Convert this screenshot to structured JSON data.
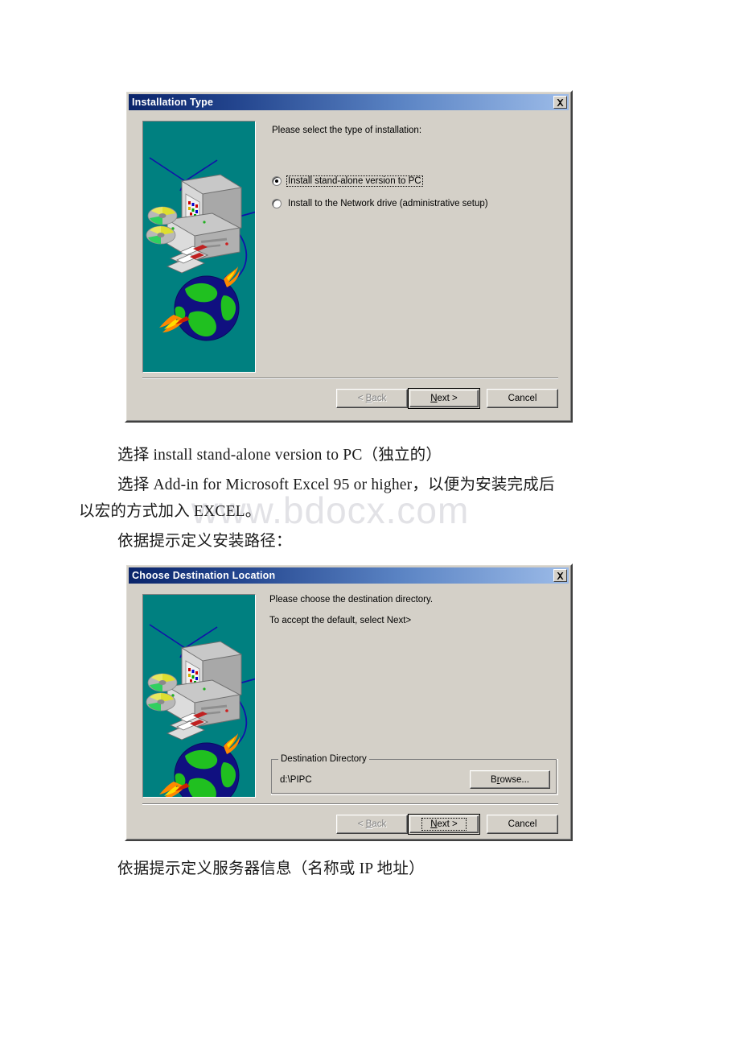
{
  "document": {
    "watermark": "www.bdocx.com",
    "paragraphs": [
      {
        "id": "p1",
        "text": "选择 install stand-alone version to PC（独立的）"
      },
      {
        "id": "p2",
        "text": "选择 Add-in for Microsoft Excel 95 or higher，以便为安装完成后"
      },
      {
        "id": "p3",
        "text": "以宏的方式加入 EXCEL。"
      },
      {
        "id": "p4",
        "text": "依据提示定义安装路径："
      },
      {
        "id": "p5",
        "text": "依据提示定义服务器信息（名称或 IP 地址）"
      }
    ]
  },
  "colors": {
    "dialog_face": "#d4d0c8",
    "title_gradient_start": "#0a246a",
    "title_gradient_end": "#9cbbe8",
    "graphic_background": "#008080",
    "page_background": "#ffffff",
    "watermark": "#e2e2e6"
  },
  "dialog1": {
    "title": "Installation Type",
    "close_tooltip": "Close",
    "prompt": "Please select the type of installation:",
    "options": [
      {
        "label": "Install stand-alone version to PC",
        "accel": "I",
        "selected": true,
        "focused": true
      },
      {
        "label": "Install to the Network drive (administrative setup)",
        "accel": "I",
        "selected": false,
        "focused": false
      }
    ],
    "buttons": {
      "back": {
        "label_pre": "< ",
        "accel": "B",
        "label_post": "ack",
        "enabled": false,
        "default": false
      },
      "next": {
        "label_pre": "",
        "accel": "N",
        "label_post": "ext >",
        "enabled": true,
        "default": true,
        "focused": false
      },
      "cancel": {
        "label": "Cancel",
        "enabled": true,
        "default": false
      }
    }
  },
  "dialog2": {
    "title": "Choose Destination Location",
    "close_tooltip": "Close",
    "prompt_line1": "Please choose the destination directory.",
    "prompt_line2": "To accept the default, select  Next>",
    "group": {
      "title": "Destination Directory",
      "path": "d:\\PIPC",
      "browse": {
        "label_pre": "B",
        "accel": "r",
        "label_post": "owse..."
      }
    },
    "buttons": {
      "back": {
        "label_pre": "< ",
        "accel": "B",
        "label_post": "ack",
        "enabled": false,
        "default": false
      },
      "next": {
        "label_pre": "",
        "accel": "N",
        "label_post": "ext >",
        "enabled": true,
        "default": true,
        "focused": true
      },
      "cancel": {
        "label": "Cancel",
        "enabled": true,
        "default": false
      }
    }
  },
  "graphic": {
    "name": "setup-illustration",
    "description": "computer-network-globe-media"
  }
}
